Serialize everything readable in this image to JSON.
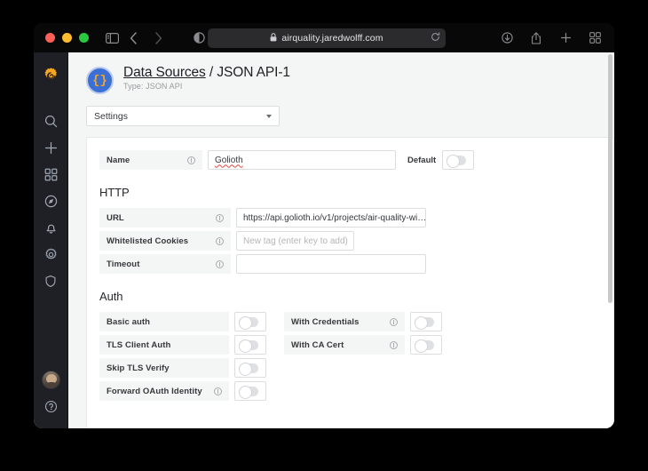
{
  "browser": {
    "url": "airquality.jaredwolff.com",
    "lock_icon": "lock-icon",
    "reload_icon": "reload-icon",
    "sidebar_toggle_icon": "sidebar-toggle-icon",
    "back_icon": "chevron-left-icon",
    "forward_icon": "chevron-right-icon",
    "shield_icon": "privacy-report-icon",
    "download_icon": "downloads-icon",
    "share_icon": "share-icon",
    "newtab_icon": "plus-icon",
    "tabs_icon": "tab-overview-icon"
  },
  "sidebar": {
    "items": [
      {
        "name": "grafana-logo",
        "label": "Grafana"
      },
      {
        "name": "search-icon",
        "label": "Search"
      },
      {
        "name": "plus-icon",
        "label": "Create"
      },
      {
        "name": "dashboards-icon",
        "label": "Dashboards"
      },
      {
        "name": "explore-compass-icon",
        "label": "Explore"
      },
      {
        "name": "alerting-bell-icon",
        "label": "Alerting"
      },
      {
        "name": "configuration-gear-icon",
        "label": "Configuration"
      },
      {
        "name": "server-admin-shield-icon",
        "label": "Server Admin"
      },
      {
        "name": "avatar",
        "label": "User profile"
      },
      {
        "name": "help-icon",
        "label": "Help"
      }
    ]
  },
  "header": {
    "breadcrumb_parent": "Data Sources",
    "breadcrumb_separator": " / ",
    "breadcrumb_current": "JSON API-1",
    "subtitle": "Type: JSON API",
    "datasource_icon": "{}"
  },
  "tab_select": {
    "value": "Settings",
    "caret_icon": "chevron-down-icon"
  },
  "settings": {
    "name_field": {
      "label": "Name",
      "value": "Golioth",
      "info_icon": "info-icon"
    },
    "default_toggle": {
      "label": "Default",
      "state": "off"
    }
  },
  "http": {
    "title": "HTTP",
    "rows": [
      {
        "label": "URL",
        "value": "https://api.golioth.io/v1/projects/air-quality-wi…",
        "placeholder": "",
        "info_icon": "info-icon"
      },
      {
        "label": "Whitelisted Cookies",
        "value": "",
        "placeholder": "New tag (enter key to add)",
        "info_icon": "info-icon"
      },
      {
        "label": "Timeout",
        "value": "",
        "placeholder": "",
        "info_icon": "info-icon"
      }
    ]
  },
  "auth": {
    "title": "Auth",
    "left_rows": [
      {
        "label": "Basic auth",
        "has_info": false,
        "state": "off"
      },
      {
        "label": "TLS Client Auth",
        "has_info": false,
        "state": "off"
      },
      {
        "label": "Skip TLS Verify",
        "has_info": false,
        "state": "off"
      },
      {
        "label": "Forward OAuth Identity",
        "has_info": true,
        "state": "off"
      }
    ],
    "right_rows": [
      {
        "label": "With Credentials",
        "has_info": true,
        "state": "off"
      },
      {
        "label": "With CA Cert",
        "has_info": true,
        "state": "off"
      }
    ]
  },
  "colors": {
    "grafana_orange": "#f5a623",
    "datasource_blue": "#3b6fd4",
    "page_bg": "#f4f5f5",
    "sidebar_bg": "#1f2025",
    "titlebar_bg": "#080808"
  }
}
